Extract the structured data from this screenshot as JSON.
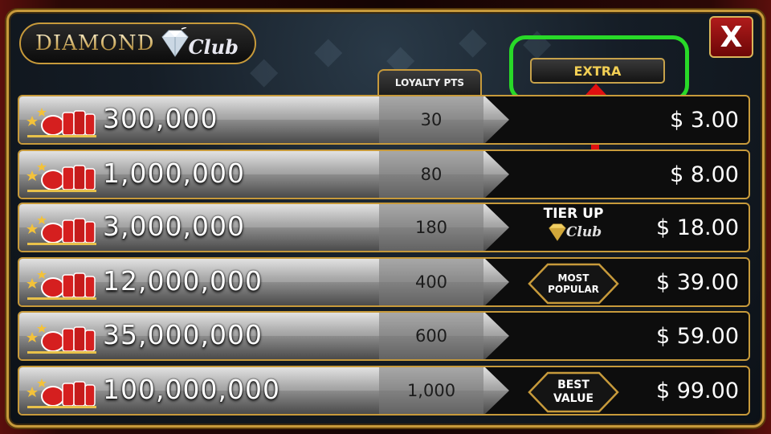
{
  "header": {
    "logo_word": "DIAMOND",
    "logo_club": "Club",
    "close_label": "X",
    "loyalty_header": "LOYALTY PTS",
    "extra_label": "EXTRA"
  },
  "rows": [
    {
      "coins": "300,000",
      "points": "30",
      "price": "$ 3.00",
      "badge": ""
    },
    {
      "coins": "1,000,000",
      "points": "80",
      "price": "$ 8.00",
      "badge": ""
    },
    {
      "coins": "3,000,000",
      "points": "180",
      "price": "$ 18.00",
      "badge": "tier"
    },
    {
      "coins": "12,000,000",
      "points": "400",
      "price": "$ 39.00",
      "badge": "popular"
    },
    {
      "coins": "35,000,000",
      "points": "600",
      "price": "$ 59.00",
      "badge": ""
    },
    {
      "coins": "100,000,000",
      "points": "1,000",
      "price": "$ 99.00",
      "badge": "best"
    }
  ],
  "badges": {
    "tier_up_label": "TIER UP",
    "tier_up_club": "Club",
    "most_popular": [
      "MOST",
      "POPULAR"
    ],
    "best_value": [
      "BEST",
      "VALUE"
    ]
  },
  "colors": {
    "gold": "#c79a3b",
    "annotation_green": "#28d928",
    "annotation_red": "#e01010",
    "close_red": "#b01b1b",
    "extra_text": "#f2cf54"
  },
  "icons": [
    "diamond-gem-icon",
    "chip-stack-icon",
    "star-icon",
    "red-arrow-icon"
  ]
}
